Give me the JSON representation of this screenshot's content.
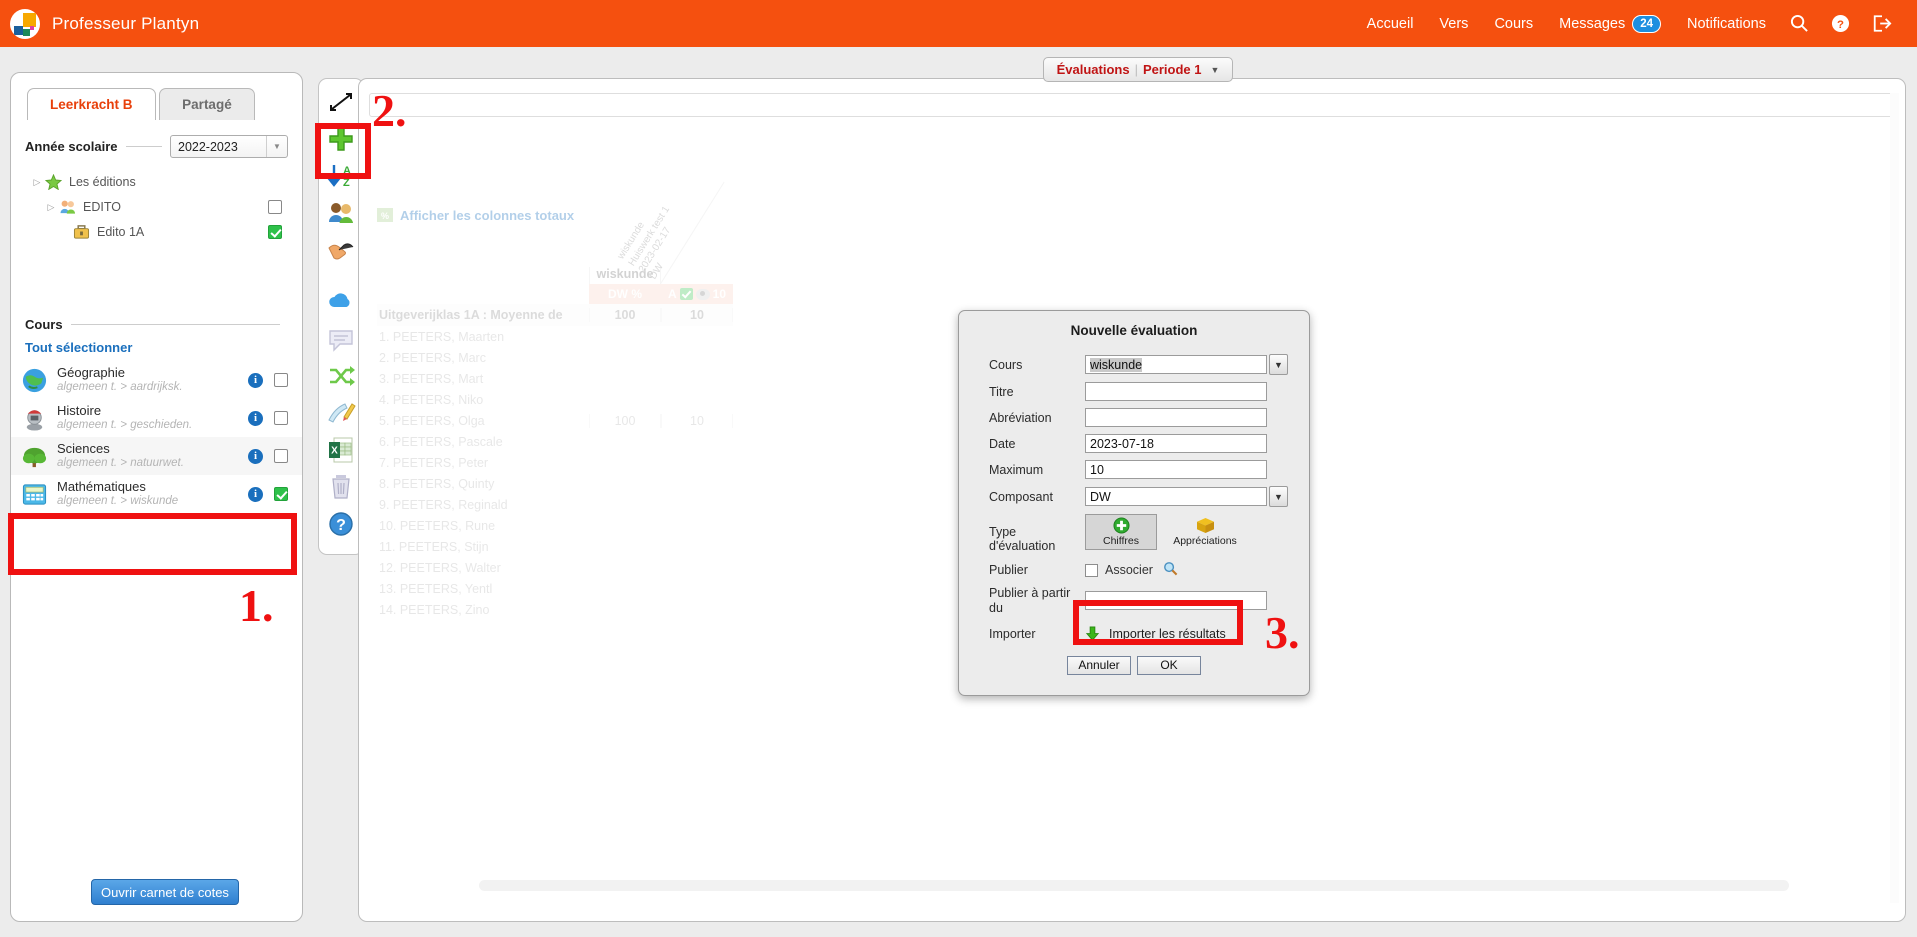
{
  "topbar": {
    "brand": "Professeur Plantyn",
    "logo_icon": "plantyn-logo-icon",
    "nav": [
      {
        "label": "Accueil"
      },
      {
        "label": "Vers"
      },
      {
        "label": "Cours"
      },
      {
        "label": "Messages",
        "badge": "24"
      },
      {
        "label": "Notifications"
      }
    ],
    "icons": [
      "search-icon",
      "help-icon",
      "logout-icon"
    ]
  },
  "sidebar": {
    "tabs": [
      {
        "label": "Leerkracht B",
        "active": true
      },
      {
        "label": "Partagé",
        "active": false
      }
    ],
    "year_label": "Année scolaire",
    "year_value": "2022-2023",
    "tree": [
      {
        "label": "Les éditions",
        "icon": "star-icon",
        "depth": 0,
        "expander": "▷",
        "checkbox": null
      },
      {
        "label": "EDITO",
        "icon": "group-icon",
        "depth": 1,
        "expander": "▷",
        "checkbox": "off"
      },
      {
        "label": "Edito 1A",
        "icon": "briefcase-icon",
        "depth": 2,
        "expander": "",
        "checkbox": "on"
      }
    ],
    "courses_label": "Cours",
    "select_all": "Tout sélectionner",
    "courses": [
      {
        "name": "Géographie",
        "sub": "algemeen t. > aardrijksk.",
        "icon": "globe-icon",
        "checkbox": "off",
        "highlight": false
      },
      {
        "name": "Histoire",
        "sub": "algemeen t. > geschieden.",
        "icon": "knight-icon",
        "checkbox": "off",
        "highlight": false
      },
      {
        "name": "Sciences",
        "sub": "algemeen t. > natuurwet.",
        "icon": "tree-icon",
        "checkbox": "off",
        "highlight": true
      },
      {
        "name": "Mathématiques",
        "sub": "algemeen t. > wiskunde",
        "icon": "calculator-icon",
        "checkbox": "on",
        "highlight": false
      }
    ],
    "info_glyph": "i",
    "open_button": "Ouvrir carnet de cotes"
  },
  "toolbar": {
    "buttons": [
      {
        "name": "expand-icon"
      },
      {
        "name": "add-icon"
      },
      {
        "name": "sort-az-icon"
      },
      {
        "name": "students-icon"
      },
      {
        "name": "handshake-icon"
      },
      {
        "name": "cloud-icon"
      },
      {
        "name": "comment-icon"
      },
      {
        "name": "shuffle-icon"
      },
      {
        "name": "edit-icon"
      },
      {
        "name": "excel-icon"
      },
      {
        "name": "trash-icon"
      },
      {
        "name": "help-icon"
      }
    ]
  },
  "main": {
    "period_title": "Évaluations",
    "period_separator": "|",
    "period_value": "Periode 1",
    "totals_link": "Afficher les colonnes totaux",
    "table": {
      "course_header": "wiskunde",
      "col1_sub": "DW %",
      "col2_sub_letter": "A",
      "col2_sub_value": "10",
      "rotated_header": [
        "wiskunde",
        "Huiswerk test 1",
        "2023-02-17",
        "DW"
      ],
      "average_row": {
        "label": "Uitgeverijklas 1A : Moyenne de",
        "c1": "100",
        "c2": "10"
      },
      "rows": [
        {
          "label": "1. PEETERS, Maarten",
          "c1": "",
          "c2": ""
        },
        {
          "label": "2. PEETERS, Marc",
          "c1": "",
          "c2": ""
        },
        {
          "label": "3. PEETERS, Mart",
          "c1": "",
          "c2": ""
        },
        {
          "label": "4. PEETERS, Niko",
          "c1": "",
          "c2": ""
        },
        {
          "label": "5. PEETERS, Olga",
          "c1": "100",
          "c2": "10"
        },
        {
          "label": "6. PEETERS, Pascale",
          "c1": "",
          "c2": ""
        },
        {
          "label": "7. PEETERS, Peter",
          "c1": "",
          "c2": ""
        },
        {
          "label": "8. PEETERS, Quinty",
          "c1": "",
          "c2": ""
        },
        {
          "label": "9. PEETERS, Reginald",
          "c1": "",
          "c2": ""
        },
        {
          "label": "10. PEETERS, Rune",
          "c1": "",
          "c2": ""
        },
        {
          "label": "11. PEETERS, Stijn",
          "c1": "",
          "c2": ""
        },
        {
          "label": "12. PEETERS, Walter",
          "c1": "",
          "c2": ""
        },
        {
          "label": "13. PEETERS, Yentl",
          "c1": "",
          "c2": ""
        },
        {
          "label": "14. PEETERS, Zino",
          "c1": "",
          "c2": ""
        }
      ]
    }
  },
  "modal": {
    "title": "Nouvelle évaluation",
    "fields": {
      "cours_label": "Cours",
      "cours_value": "wiskunde",
      "titre_label": "Titre",
      "titre_value": "",
      "abrev_label": "Abréviation",
      "abrev_value": "",
      "date_label": "Date",
      "date_value": "2023-07-18",
      "max_label": "Maximum",
      "max_value": "10",
      "composant_label": "Composant",
      "composant_value": "DW",
      "type_label": "Type d'évaluation",
      "type_option_1": "Chiffres",
      "type_option_2": "Appréciations",
      "publier_label": "Publier",
      "associer_label": "Associer",
      "publier_from_label": "Publier à partir du",
      "publier_from_value": "",
      "importer_label": "Importer",
      "importer_link": "Importer les résultats"
    },
    "buttons": {
      "cancel": "Annuler",
      "ok": "OK"
    }
  },
  "annotations": {
    "step1": "1.",
    "step2": "2.",
    "step3": "3.",
    "color": "#ef1111"
  }
}
